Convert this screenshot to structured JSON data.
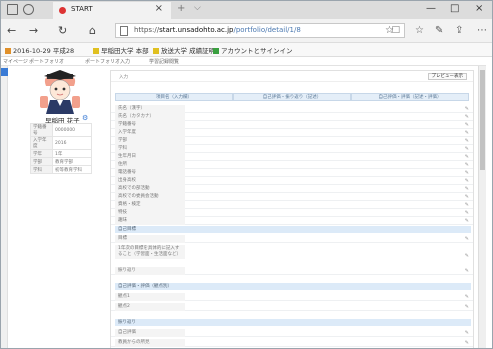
{
  "browser": {
    "tab_title": "START",
    "close_glyph": "×",
    "new_tab_glyph": "+",
    "more_glyph": "⌵",
    "win_min": "—",
    "win_max": "□",
    "win_close": "×",
    "url_prefix": "https://",
    "url_host": "start.unsadohto.ac.jp",
    "url_path": "/portfolio/detail/1/8",
    "nav": {
      "back": "←",
      "forward": "→",
      "refresh": "↻",
      "home": "⌂"
    },
    "tools": {
      "reading": "□",
      "favorite": "☆",
      "favorites": "☆",
      "notes": "✎",
      "share": "⇪",
      "more": "⋯"
    }
  },
  "favorites": [
    {
      "label": "2016-10-29 平成28",
      "color": "#e0902a"
    },
    {
      "label": "早稲田大学 本部",
      "color": "#e0c020"
    },
    {
      "label": "放送大学 成績証明",
      "color": "#e0c020"
    },
    {
      "label": "アカウントとサインイン",
      "color": "#3aa040"
    }
  ],
  "app_nav": [
    "マイページ",
    "ポートフォリオ",
    "ポートフォリオ入力",
    "学習記録閲覧"
  ],
  "profile": {
    "name": "早稲田 花子",
    "table": [
      [
        "学籍番号",
        "0000000"
      ],
      [
        "入学年度",
        "2016"
      ],
      [
        "学年",
        "1年"
      ],
      [
        "学部",
        "教育学部"
      ],
      [
        "学科",
        "初等教育学科"
      ]
    ]
  },
  "panel": {
    "tag": "入力",
    "top_button": "プレビュー表示",
    "header": [
      "項目名（入力欄）",
      "自己評価・振り返り（記述）",
      "自己評価・評価（記述・評価）"
    ],
    "edit_glyph": "✎",
    "rows1": [
      "氏名（漢字）",
      "氏名（カタカナ）",
      "学籍番号",
      "入学年度",
      "学部",
      "学科",
      "生年月日",
      "住所",
      "電話番号",
      "出身高校",
      "高校での部活動",
      "高校での委員会活動",
      "資格・検定",
      "特技",
      "趣味"
    ],
    "section2": "自己目標",
    "rows2": [
      "目標"
    ],
    "multi2": "1年次の目標を具体的に記入すること（学習面・生活面など）",
    "rows2b": [
      "振り返り"
    ],
    "section3": "自己評価・評価（観点別）",
    "rows3": [
      "観点1",
      "観点2"
    ],
    "section4": "振り返り",
    "rows4": [
      "自己評価",
      "教員からの所見"
    ]
  }
}
